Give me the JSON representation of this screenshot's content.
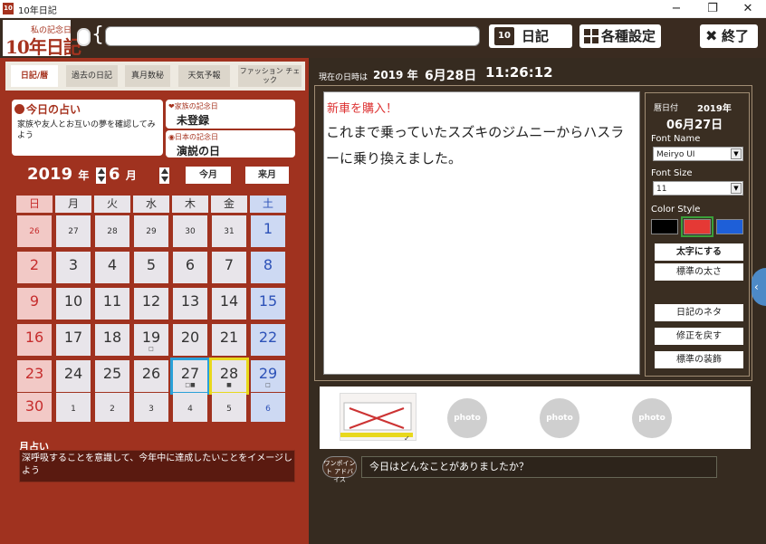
{
  "window": {
    "title": "10年日記",
    "minimize": "−",
    "maximize": "❐",
    "close": "✕",
    "icon_text": "10"
  },
  "header": {
    "logo_sub": "私の記念日",
    "logo_main": "10年日記",
    "hint_text": "",
    "buttons": {
      "diary_icon": "10",
      "diary": "日記",
      "settings": "各種設定",
      "exit": "終了"
    }
  },
  "tabs": [
    "日記/暦",
    "過去の日記",
    "真月数秘",
    "天気予報",
    "ファッション チェック"
  ],
  "fortune": {
    "title": "今日の占い",
    "text": "家族や友人とお互いの夢を確認してみよう"
  },
  "family_anniv": {
    "label": "家族の記念日",
    "value": "未登録"
  },
  "japan_anniv": {
    "label": "日本の記念日",
    "value": "演説の日"
  },
  "calendar": {
    "year": "2019",
    "year_unit": "年",
    "month": "6",
    "month_unit": "月",
    "this_month_btn": "今月",
    "next_month_btn": "来月",
    "weekdays": [
      "日",
      "月",
      "火",
      "水",
      "木",
      "金",
      "土"
    ],
    "weeks": [
      [
        "26",
        "27",
        "28",
        "29",
        "30",
        "31",
        "1"
      ],
      [
        "2",
        "3",
        "4",
        "5",
        "6",
        "7",
        "8"
      ],
      [
        "9",
        "10",
        "11",
        "12",
        "13",
        "14",
        "15"
      ],
      [
        "16",
        "17",
        "18",
        "19",
        "20",
        "21",
        "22"
      ],
      [
        "23",
        "24",
        "25",
        "26",
        "27",
        "28",
        "29"
      ],
      [
        "30",
        "1",
        "2",
        "3",
        "4",
        "5",
        "6"
      ]
    ],
    "marks": {
      "19": "□",
      "27": "□■",
      "28": "■",
      "29": "□"
    },
    "selected_color": "#2aa0d8",
    "today_color": "#e8d81c"
  },
  "monthly": {
    "title": "月占い",
    "text": "深呼吸することを意識して、今年中に達成したいことをイメージしよう"
  },
  "datetime": {
    "label": "現在の日時は",
    "year": "2019 年",
    "date": "6月28日",
    "time": "11:26:12"
  },
  "entry": {
    "title": "新車を購入！",
    "body": "これまで乗っていたスズキのジムニーからハスラーに乗り換えました。"
  },
  "settings": {
    "date_label": "暦日付",
    "year": "2019年",
    "date": "06月27日",
    "font_name_label": "Font Name",
    "font_name": "Meiryo UI",
    "font_size_label": "Font Size",
    "font_size": "11",
    "color_style_label": "Color Style",
    "colors": [
      "#000000",
      "#e53935",
      "#1e5fd8"
    ],
    "bold_btn": "太字にする",
    "normal_btn": "標準の太さ",
    "idea_btn": "日記のネタ",
    "undo_btn": "修正を戻す",
    "default_btn": "標準の装飾"
  },
  "photos": {
    "placeholder": "photo"
  },
  "advice": {
    "icon": "ワンポイント アドバイス",
    "text": "今日はどんなことがありましたか？"
  }
}
